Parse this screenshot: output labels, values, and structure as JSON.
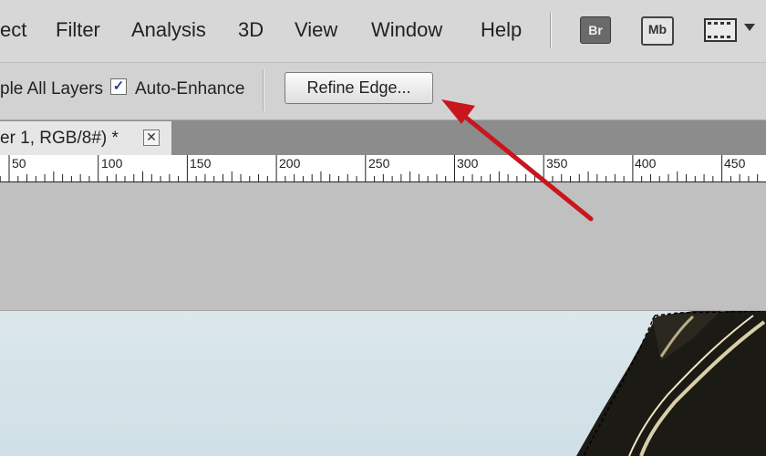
{
  "menu": {
    "items": [
      "ect",
      "Filter",
      "Analysis",
      "3D",
      "View",
      "Window",
      "Help"
    ],
    "apps": [
      {
        "label": "Br"
      },
      {
        "label": "Mb"
      }
    ]
  },
  "options": {
    "sample_all_layers": "ple All Layers",
    "auto_enhance": "Auto-Enhance",
    "auto_enhance_checked": true,
    "check_mark": "✓",
    "refine_edge": "Refine Edge..."
  },
  "document": {
    "tab_title": "er 1, RGB/8#) *",
    "close_glyph": "✕"
  },
  "ruler": {
    "labels": [
      "50",
      "100",
      "150",
      "200",
      "250",
      "300",
      "350",
      "400",
      "450"
    ]
  },
  "colors": {
    "annotation_arrow": "#c8161d",
    "selection_marching_ants": "#000000"
  }
}
